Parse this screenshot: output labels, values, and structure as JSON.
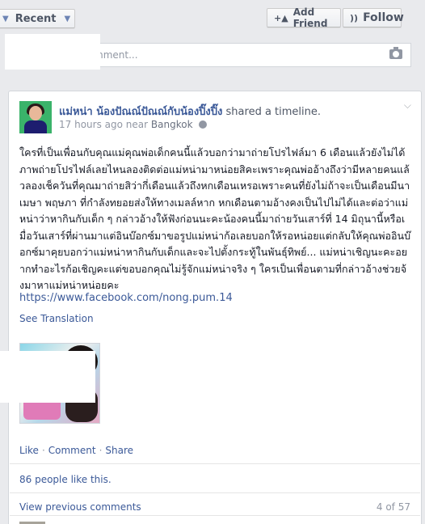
{
  "toolbar": {
    "recent_label": "Recent",
    "add_friend_label": "Add Friend",
    "follow_label": "Follow"
  },
  "composer": {
    "placeholder": "mment..."
  },
  "post": {
    "author": "แม่หน่า น้องปัณณ์ปัณณ์กับน้องปิ๊งปิ๊ง",
    "action": "shared a timeline.",
    "time": "17 hours ago",
    "near": "near",
    "location": "Bangkok",
    "body": "ใครที่เป็นเพื่อนกับคุณแม่คุณพ่อเด็กคนนี้แล้วบอกว่ามาถ่ายโปรไฟล์มา 6 เดือนแล้วยังไม่ได้ภาพถ่ายโปรไฟล์เลยไหนลองติดต่อแม่หน่ามาหน่อยสิคะเพราะคุณพ่ออ้างถึงว่ามีหลายคนแล้วลองเช็ควันที่คุณมาถ่ายสิว่ากี่เดือนแล้วถึงหกเดือนเหรอเพราะคนที่ยังไม่ถ้าจะเป็นเดือนมีนา เมษา พฤษภา ที่กำลังทยอยส่งให้ทางเมลล์หาก หกเดือนตามอ้างคงเป็นไปไม่ได้และต่อว่าแม่หน่าว่าหากินกับเด็ก ๆ กล่าวอ้างให้ฟังก่อนนะคะน้องคนนี้มาถ่ายวันเสาร์ที่ 14 มิถุนานี้หรือเมื่อวันเสาร์ที่ผ่านมาแต่อินบ๊อกซ์มาขอรูปแม่หน่าก้อเลยบอกให้รอหน่อยแต่กลับให้คุณพ่ออินบ๊อกซ์มาคุยบอกว่าแม่หน่าหากินกับเด็กและจะไปตั้งกระทู้ในพันธุ์ทิพย์... แม่หน่าเชิญนะคะอยากทำอะไรก้อเชิญคะแต่ขอบอกคุณไม่รู้จักแม่หน่าจริง ๆ ใครเป็นเพื่อนตามที่กล่าวอ้างช่วยจ้งมาหาแม่หน่าหน่อยคะ",
    "link": "https://www.facebook.com/nong.pum.14",
    "see_translation": "See Translation",
    "like_label": "Like",
    "comment_label": "Comment",
    "share_label": "Share",
    "likes_text": "86 people like this.",
    "view_previous": "View previous comments",
    "comment_count": "4 of 57"
  },
  "icons": {
    "add_friend": "add-friend-icon",
    "follow": "follow-rss-icon",
    "camera": "camera-icon",
    "globe": "globe-icon",
    "chevron": "chevron-down-icon"
  }
}
